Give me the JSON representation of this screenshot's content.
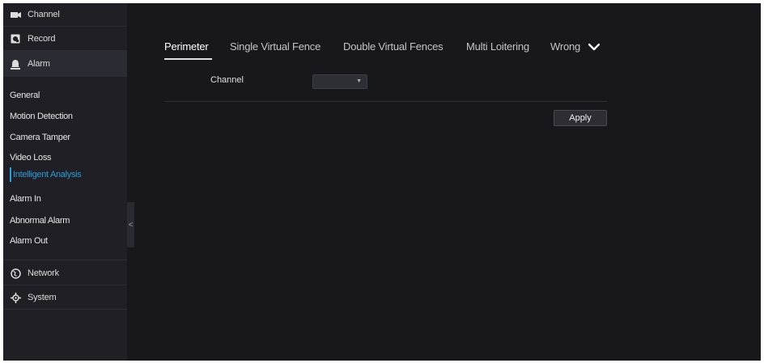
{
  "sidebar": {
    "top_items": [
      {
        "label": "Channel",
        "icon": "channel-icon"
      },
      {
        "label": "Record",
        "icon": "record-icon"
      },
      {
        "label": "Alarm",
        "icon": "alarm-icon"
      }
    ],
    "alarm_sub_items": [
      {
        "label": "General"
      },
      {
        "label": "Motion Detection"
      },
      {
        "label": "Camera Tamper"
      },
      {
        "label": "Video Loss"
      },
      {
        "label": "Intelligent Analysis",
        "active": true
      },
      {
        "label": "Alarm In"
      },
      {
        "label": "Abnormal Alarm"
      },
      {
        "label": "Alarm Out"
      }
    ],
    "bottom_items": [
      {
        "label": "Network",
        "icon": "globe-icon"
      },
      {
        "label": "System",
        "icon": "gear-icon"
      }
    ],
    "collapse_glyph": "<"
  },
  "tabs": [
    {
      "label": "Perimeter",
      "active": true
    },
    {
      "label": "Single Virtual Fence"
    },
    {
      "label": "Double Virtual Fences"
    },
    {
      "label": "Multi Loitering"
    },
    {
      "label": "Wrong"
    }
  ],
  "form": {
    "channel_label": "Channel",
    "channel_value": ""
  },
  "apply_label": "Apply",
  "colors": {
    "background": "#17171c",
    "sidebar": "#1f1f25",
    "accent": "#2f9bd9"
  }
}
